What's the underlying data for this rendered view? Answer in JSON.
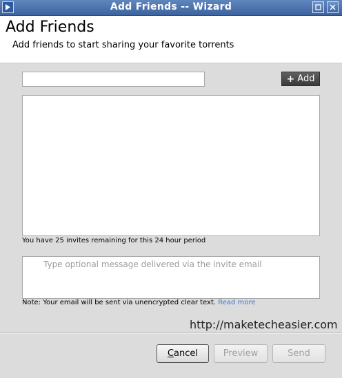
{
  "window": {
    "title": "Add Friends -- Wizard",
    "app_icon": "utorrent-logo-icon",
    "controls": [
      "restore-icon",
      "close-icon"
    ]
  },
  "header": {
    "heading": "Add Friends",
    "subheading": "Add friends to start sharing your favorite torrents"
  },
  "form": {
    "email_value": "",
    "add_button_label": "Add",
    "add_button_icon": "plus-icon",
    "invites_remaining_text": "You have 25 invites remaining for this 24 hour period",
    "message_placeholder": "Type optional message delivered via the invite email",
    "note_text": "Note: Your email will be sent via unencrypted clear text.",
    "read_more_link": "Read more"
  },
  "watermark": "http://maketecheasier.com",
  "footer": {
    "cancel_label": "Cancel",
    "preview_label": "Preview",
    "send_label": "Send"
  },
  "colors": {
    "titlebar": "#4a71ad",
    "link": "#3a7bd0",
    "add_button": "#4a4a4a"
  }
}
